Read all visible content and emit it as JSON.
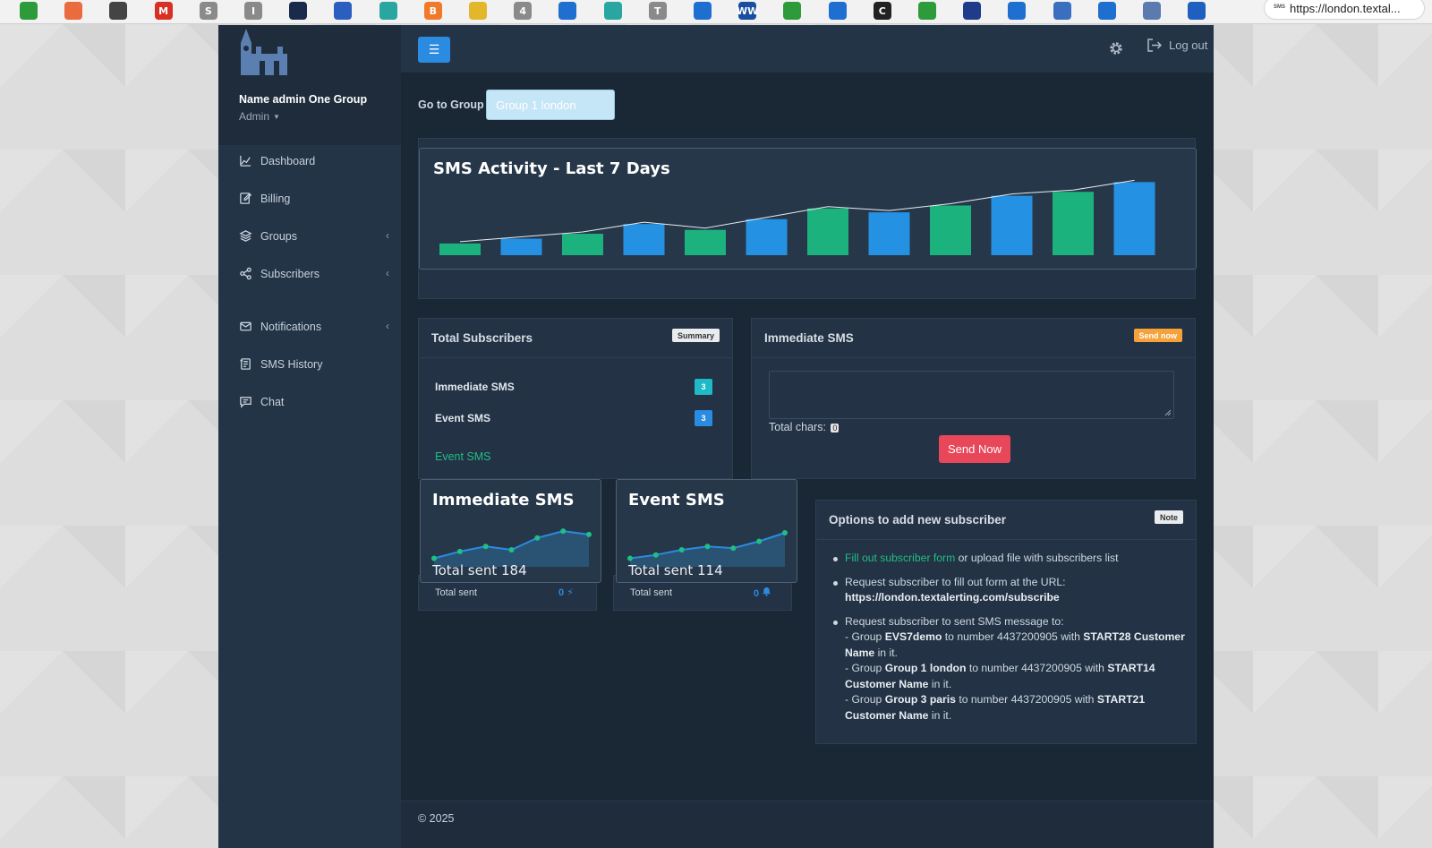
{
  "browser": {
    "url": "https://london.textal...",
    "url_favicon_text": "SMS",
    "bookmarks": [
      {
        "name": "bookmark-1",
        "color": "#2e9b3b",
        "glyph": ""
      },
      {
        "name": "bookmark-2",
        "color": "#ea6b3d",
        "glyph": ""
      },
      {
        "name": "bookmark-3",
        "color": "#444444",
        "glyph": ""
      },
      {
        "name": "bookmark-gmail",
        "color": "#d93025",
        "glyph": "M"
      },
      {
        "name": "bookmark-5",
        "color": "#8a8a8a",
        "glyph": "S"
      },
      {
        "name": "bookmark-6",
        "color": "#8a8a8a",
        "glyph": "I"
      },
      {
        "name": "bookmark-7",
        "color": "#1a2a4a",
        "glyph": ""
      },
      {
        "name": "bookmark-8",
        "color": "#2b5fbf",
        "glyph": ""
      },
      {
        "name": "bookmark-9",
        "color": "#2aa6a0",
        "glyph": ""
      },
      {
        "name": "bookmark-10",
        "color": "#f07a2a",
        "glyph": "B"
      },
      {
        "name": "bookmark-11",
        "color": "#e2b82a",
        "glyph": ""
      },
      {
        "name": "bookmark-12",
        "color": "#8a8a8a",
        "glyph": "4"
      },
      {
        "name": "bookmark-13",
        "color": "#1f6fd0",
        "glyph": ""
      },
      {
        "name": "bookmark-14",
        "color": "#2aa6a0",
        "glyph": ""
      },
      {
        "name": "bookmark-15",
        "color": "#8a8a8a",
        "glyph": "T"
      },
      {
        "name": "bookmark-16",
        "color": "#1f6fd0",
        "glyph": ""
      },
      {
        "name": "bookmark-17",
        "color": "#1a4fa0",
        "glyph": "WW"
      },
      {
        "name": "bookmark-18",
        "color": "#2e9b3b",
        "glyph": ""
      },
      {
        "name": "bookmark-19",
        "color": "#1f6fd0",
        "glyph": ""
      },
      {
        "name": "bookmark-20",
        "color": "#222222",
        "glyph": "C"
      },
      {
        "name": "bookmark-21",
        "color": "#2e9b3b",
        "glyph": ""
      },
      {
        "name": "bookmark-22",
        "color": "#1f3c8a",
        "glyph": ""
      },
      {
        "name": "bookmark-23",
        "color": "#1f6fd0",
        "glyph": ""
      },
      {
        "name": "bookmark-24",
        "color": "#3a6fc0",
        "glyph": ""
      },
      {
        "name": "bookmark-25",
        "color": "#1f6fd0",
        "glyph": ""
      },
      {
        "name": "bookmark-26",
        "color": "#5a7ab0",
        "glyph": ""
      },
      {
        "name": "bookmark-27",
        "color": "#1f5fc0",
        "glyph": ""
      }
    ]
  },
  "sidebar": {
    "user_name": "Name admin One Group",
    "user_role": "Admin",
    "items": [
      {
        "label": "Dashboard",
        "icon": "chart-icon",
        "has_submenu": false
      },
      {
        "label": "Billing",
        "icon": "edit-icon",
        "has_submenu": false
      },
      {
        "label": "Groups",
        "icon": "layers-icon",
        "has_submenu": true
      },
      {
        "label": "Subscribers",
        "icon": "share-icon",
        "has_submenu": true
      },
      {
        "label": "Notifications",
        "icon": "envelope-icon",
        "has_submenu": true
      },
      {
        "label": "SMS History",
        "icon": "history-icon",
        "has_submenu": false
      },
      {
        "label": "Chat",
        "icon": "chat-icon",
        "has_submenu": false
      }
    ]
  },
  "header": {
    "logout_label": "Log out"
  },
  "goto": {
    "label": "Go to Group",
    "value": "Group 1 london"
  },
  "chart_data": [
    {
      "type": "bar",
      "title": "SMS Activity - Last 7 Days",
      "categories": [
        "",
        "",
        "",
        "",
        "",
        "",
        "",
        "",
        "",
        "",
        "",
        ""
      ],
      "values": [
        12,
        17,
        22,
        32,
        26,
        37,
        48,
        44,
        51,
        61,
        65,
        75
      ],
      "trend_line": true,
      "colors": [
        "#1cb27e",
        "#2591e2"
      ],
      "ylim": [
        0,
        90
      ],
      "xlabel": "",
      "ylabel": ""
    },
    {
      "type": "area",
      "title": "Immediate SMS",
      "subtitle": "Total sent 184",
      "values": [
        5,
        9,
        12,
        10,
        17,
        21,
        19
      ],
      "ylim": [
        0,
        30
      ]
    },
    {
      "type": "area",
      "title": "Event SMS",
      "subtitle": "Total sent 114",
      "values": [
        5,
        7,
        10,
        12,
        11,
        15,
        20
      ],
      "ylim": [
        0,
        30
      ]
    }
  ],
  "total_subscribers": {
    "title": "Total Subscribers",
    "tag": "Summary",
    "rows": [
      {
        "label": "Immediate SMS",
        "count": "3",
        "color": "#1fb9c7"
      },
      {
        "label": "Event SMS",
        "count": "3",
        "color": "#2a8be0"
      }
    ],
    "link": "Event SMS"
  },
  "immediate_sms": {
    "title": "Immediate SMS",
    "tag": "Send now",
    "chars_label": "Total chars:",
    "chars_value": "0",
    "send_label": "Send Now"
  },
  "mini_cards": [
    {
      "title": "Immediate SMS",
      "total": "Total sent 184",
      "foot_label": "Total sent",
      "foot_value": "0",
      "foot_icon": "bolt-icon"
    },
    {
      "title": "Event SMS",
      "total": "Total sent 114",
      "foot_label": "Total sent",
      "foot_value": "0",
      "foot_icon": "bell-icon"
    }
  ],
  "options": {
    "title": "Options to add new subscriber",
    "tag": "Note",
    "item1_link": "Fill out subscriber form",
    "item1_rest": " or upload file with subscribers list",
    "item2_text": "Request subscriber to fill out form at the URL:",
    "item2_url": "https://london.textalerting.com/subscribe",
    "item3_text": "Request subscriber to sent SMS message to:",
    "groups": [
      {
        "prefix": "- Group ",
        "name": "EVS7demo",
        "mid": " to number 4437200905 with ",
        "code": "START28 Customer Name",
        "suffix": " in it."
      },
      {
        "prefix": "- Group ",
        "name": "Group 1 london",
        "mid": " to number 4437200905 with ",
        "code": "START14 Customer Name",
        "suffix": " in it."
      },
      {
        "prefix": "- Group ",
        "name": "Group 3 paris",
        "mid": " to number 4437200905 with ",
        "code": "START21 Customer Name",
        "suffix": " in it."
      }
    ]
  },
  "footer": {
    "copyright": "© 2025"
  }
}
